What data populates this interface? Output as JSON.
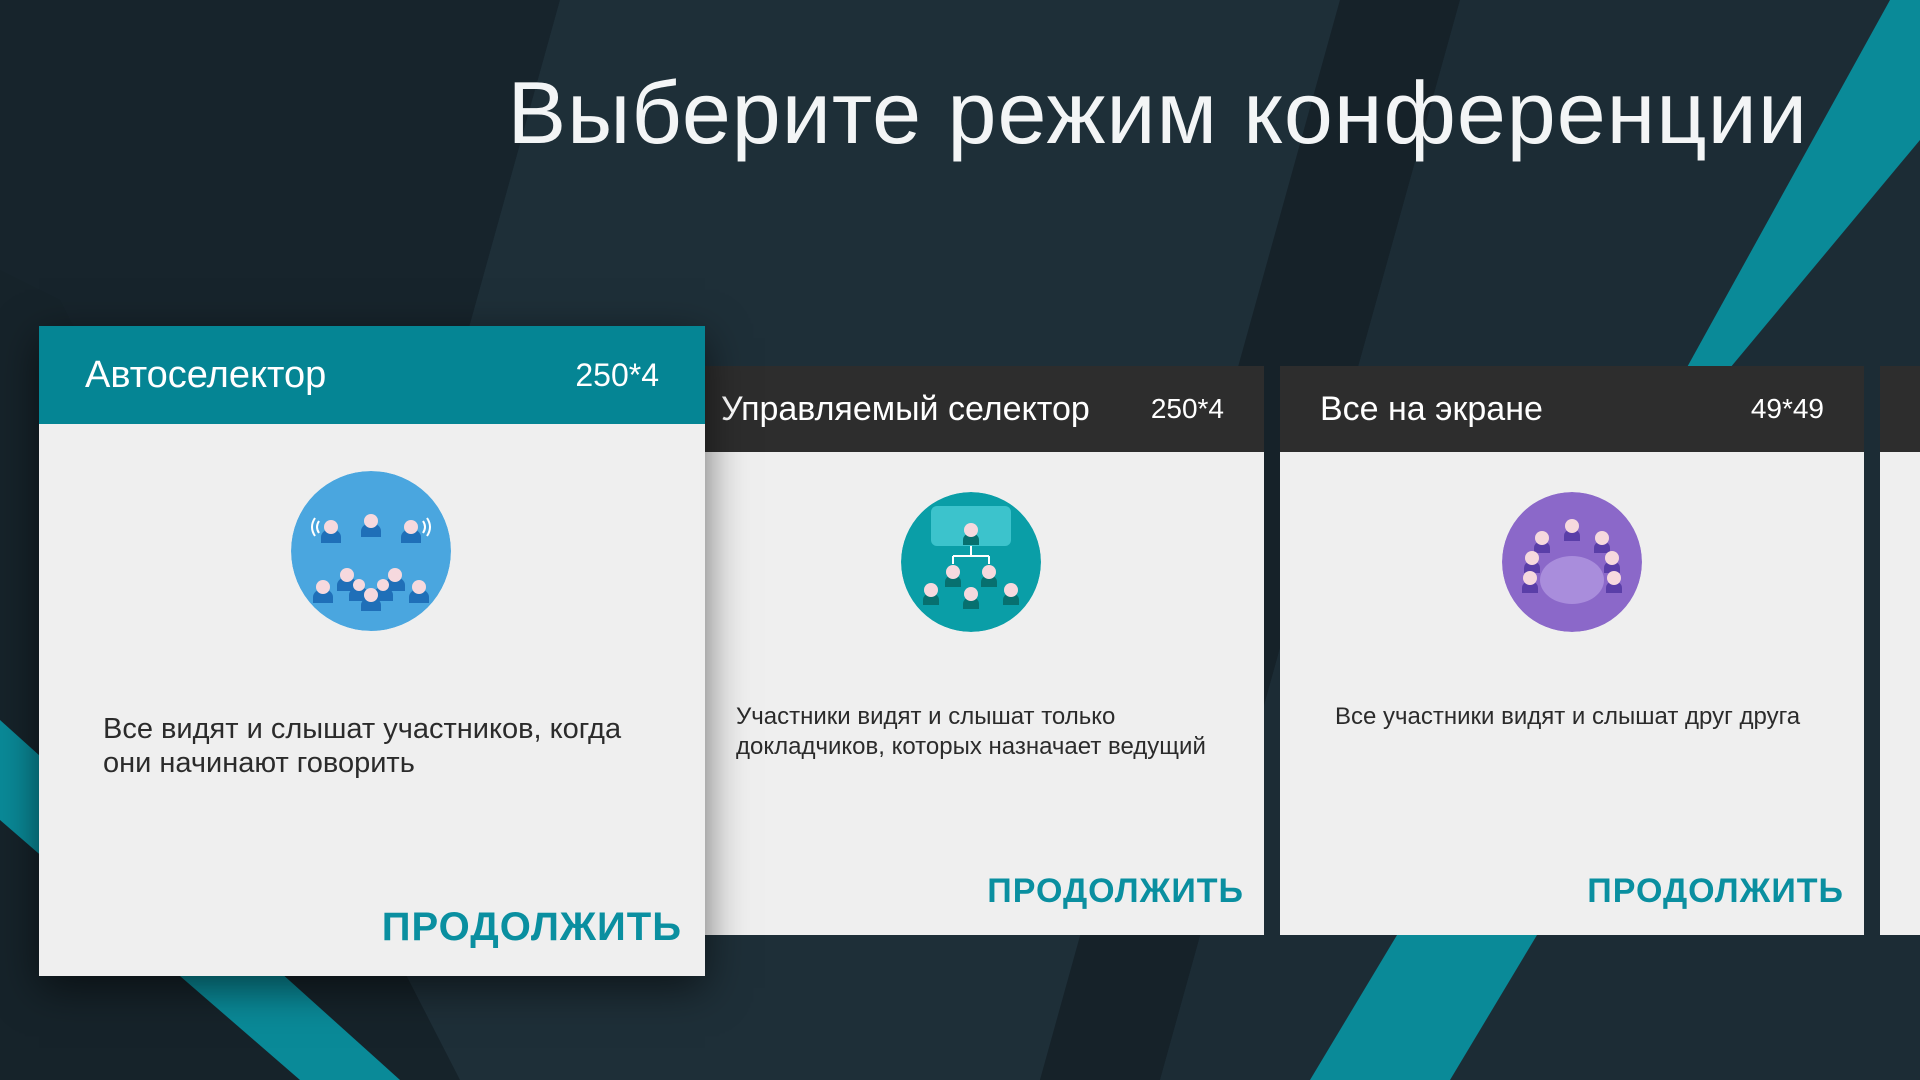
{
  "page": {
    "title": "Выберите режим конференции"
  },
  "colors": {
    "background": "#1b2a33",
    "accent": "#058594",
    "header_inactive": "#2d2d2d",
    "card_body": "#efefef",
    "continue_text": "#0a8fa0"
  },
  "cards": [
    {
      "title": "Автоселектор",
      "count": "250*4",
      "description": "Все видят и слышат участников, когда они начинают говорить",
      "action": "ПРОДОЛЖИТЬ",
      "icon": "auto-selector-icon",
      "focused": true
    },
    {
      "title": "Управляемый селектор",
      "count": "250*4",
      "description": "Участники видят и слышат только докладчиков, которых назначает ведущий",
      "action": "ПРОДОЛЖИТЬ",
      "icon": "managed-selector-icon",
      "focused": false
    },
    {
      "title": "Все на экране",
      "count": "49*49",
      "description": "Все участники видят и слышат друг друга",
      "action": "ПРОДОЛЖИТЬ",
      "icon": "all-on-screen-icon",
      "focused": false
    }
  ]
}
